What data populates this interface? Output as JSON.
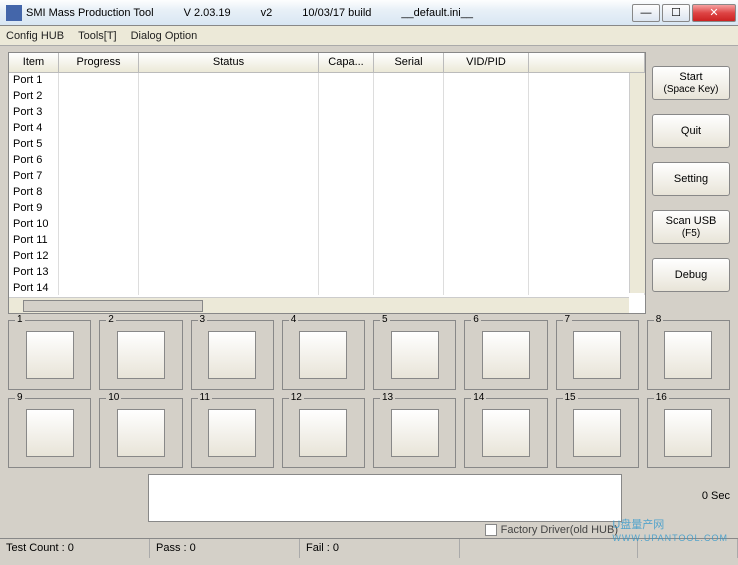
{
  "title": {
    "app": "SMI Mass Production Tool",
    "version": "V 2.03.19",
    "subver": "v2",
    "build": "10/03/17 build",
    "config": "__default.ini__"
  },
  "menu": {
    "items": [
      "Config HUB",
      "Tools[T]",
      "Dialog Option"
    ]
  },
  "table": {
    "headers": {
      "item": "Item",
      "progress": "Progress",
      "status": "Status",
      "capacity": "Capa...",
      "serial": "Serial",
      "vidpid": "VID/PID"
    },
    "rows": [
      "Port 1",
      "Port 2",
      "Port 3",
      "Port 4",
      "Port 5",
      "Port 6",
      "Port 7",
      "Port 8",
      "Port 9",
      "Port 10",
      "Port 11",
      "Port 12",
      "Port 13",
      "Port 14"
    ]
  },
  "buttons": {
    "start": "Start",
    "start_sub": "(Space Key)",
    "quit": "Quit",
    "setting": "Setting",
    "scan": "Scan USB",
    "scan_sub": "(F5)",
    "debug": "Debug"
  },
  "ports": [
    "1",
    "2",
    "3",
    "4",
    "5",
    "6",
    "7",
    "8",
    "9",
    "10",
    "11",
    "12",
    "13",
    "14",
    "15",
    "16"
  ],
  "timer": "0 Sec",
  "checkbox_label": "Factory Driver(old HUB)",
  "status": {
    "test": "Test Count : 0",
    "pass": "Pass : 0",
    "fail": "Fail : 0"
  },
  "watermark": {
    "main": "U盘量产网",
    "sub": "WWW.UPANTOOL.COM"
  }
}
